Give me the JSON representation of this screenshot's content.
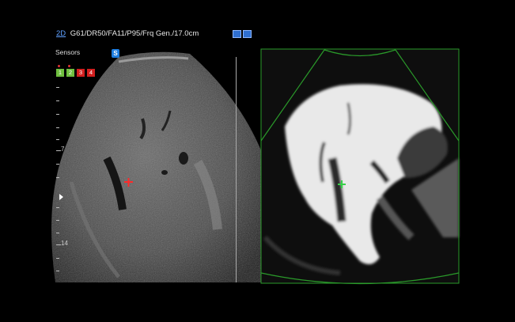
{
  "header": {
    "mode": "2D",
    "params": "G61/DR50/FA11/P95/Frq Gen./17.0cm"
  },
  "sensors": {
    "label": "Sensors",
    "items": [
      {
        "label": "1",
        "color": "#6fbf3f"
      },
      {
        "label": "2",
        "color": "#6fbf3f"
      },
      {
        "label": "3",
        "color": "#d21f1f"
      },
      {
        "label": "4",
        "color": "#d21f1f"
      }
    ]
  },
  "probe_orientation_badge": "S",
  "depth_scale": {
    "labels": [
      "7",
      "14"
    ]
  },
  "colors": {
    "crosshair_ultrasound": "#ff2a2a",
    "crosshair_mri": "#39d04a",
    "sector_outline": "#2a9a2a",
    "header_accent": "#5ea0ff"
  },
  "icons": [
    "probe-icon",
    "settings-icon",
    "focus-marker-icon"
  ]
}
